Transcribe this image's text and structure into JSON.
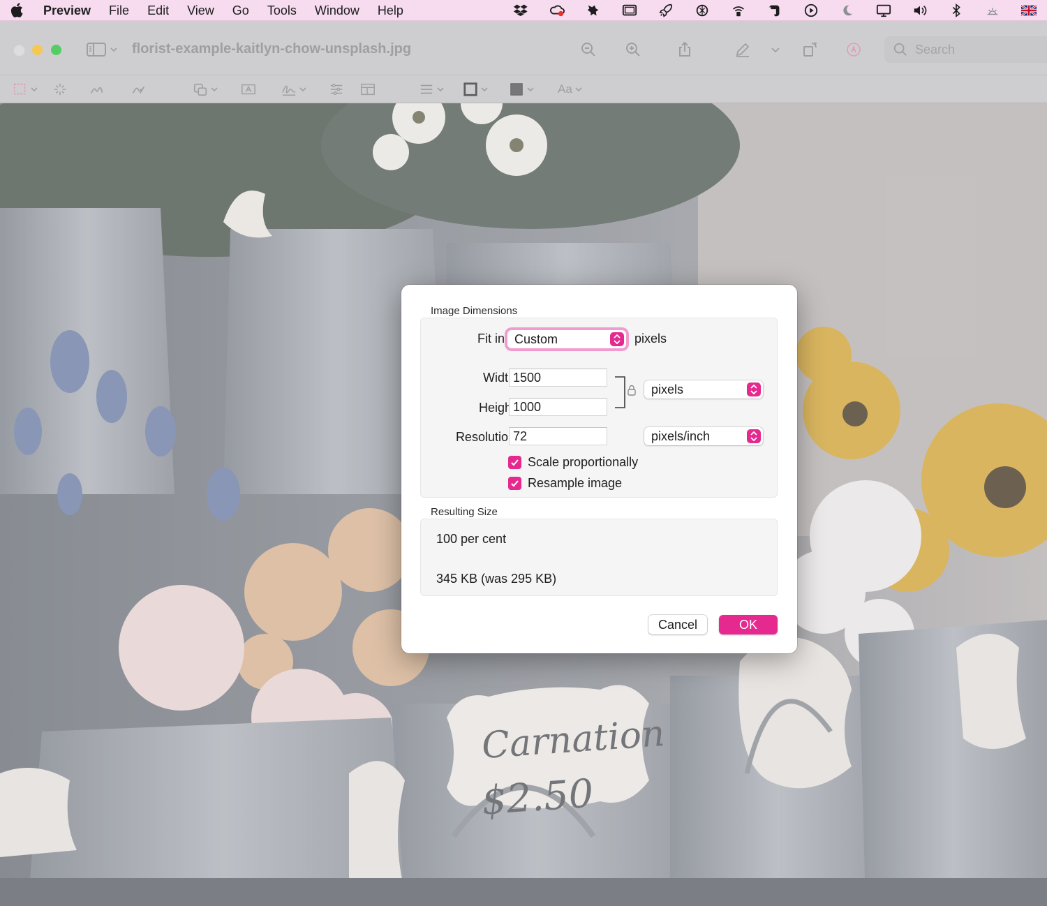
{
  "menubar": {
    "app_name": "Preview",
    "items": [
      "File",
      "Edit",
      "View",
      "Go",
      "Tools",
      "Window",
      "Help"
    ],
    "status_icons": [
      "dropbox-icon",
      "creative-cloud-icon",
      "app-icon",
      "window-icon",
      "rocket-icon",
      "openai-icon",
      "hotspot-icon",
      "evernote-icon",
      "play-icon",
      "moon-icon",
      "display-icon",
      "volume-icon",
      "bluetooth-icon",
      "brightness-icon",
      "uk-flag-icon"
    ]
  },
  "window": {
    "title": "florist-example-kaitlyn-chow-unsplash.jpg",
    "search_placeholder": "Search",
    "markup_font_label": "Aa"
  },
  "photo": {
    "label_line1": "Carnation",
    "label_line2": "$2.50"
  },
  "dialog": {
    "dimensions_title": "Image Dimensions",
    "fit_into_label": "Fit into:",
    "fit_into_value": "Custom",
    "fit_into_unit": "pixels",
    "width_label": "Width:",
    "width_value": "1500",
    "height_label": "Height:",
    "height_value": "1000",
    "size_unit": "pixels",
    "resolution_label": "Resolution:",
    "resolution_value": "72",
    "resolution_unit": "pixels/inch",
    "scale_label": "Scale proportionally",
    "scale_checked": true,
    "resample_label": "Resample image",
    "resample_checked": true,
    "result_title": "Resulting Size",
    "result_percent": "100 per cent",
    "result_size": "345 KB (was 295 KB)",
    "cancel_label": "Cancel",
    "ok_label": "OK"
  },
  "colors": {
    "accent": "#e5298f",
    "menubar_bg": "#f7dcef"
  }
}
